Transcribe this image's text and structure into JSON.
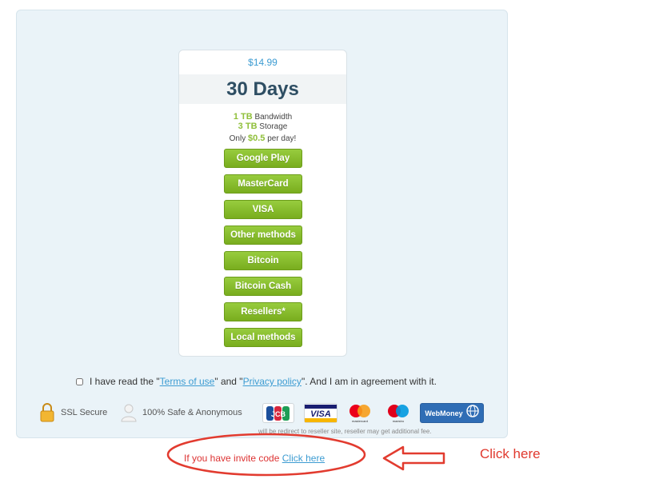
{
  "plan": {
    "price": "$14.99",
    "duration": "30 Days",
    "bandwidth_amount": "1 TB",
    "bandwidth_label": "Bandwidth",
    "storage_amount": "3 TB",
    "storage_label": "Storage",
    "per_day_prefix": "Only",
    "per_day_value": "$0.5",
    "per_day_suffix": "per day!"
  },
  "payment_buttons": [
    "Google Play",
    "MasterCard",
    "VISA",
    "Other methods",
    "Bitcoin",
    "Bitcoin Cash",
    "Resellers*",
    "Local methods"
  ],
  "agreement": {
    "prefix": "I have read the \"",
    "terms_link": "Terms of use",
    "middle": "\" and \"",
    "privacy_link": "Privacy policy",
    "suffix": "\". And I am in agreement with it."
  },
  "trust": {
    "ssl": "SSL Secure",
    "safe": "100% Safe & Anonymous"
  },
  "payment_logos": {
    "jcb": "JCB",
    "visa": "VISA",
    "mastercard": "mastercard",
    "maestro": "maestro",
    "webmoney": "WebMoney"
  },
  "reseller_note": "will be redirect to reseller site, reseller may get additional fee.",
  "invite": {
    "prefix": "If you have invite code",
    "link": "Click here"
  },
  "annotation": {
    "text": "Click here",
    "color": "#e03a2f"
  },
  "colors": {
    "accent_green": "#8fbf3a",
    "link_blue": "#3d9cd2",
    "panel_bg": "#eaf3f8"
  }
}
